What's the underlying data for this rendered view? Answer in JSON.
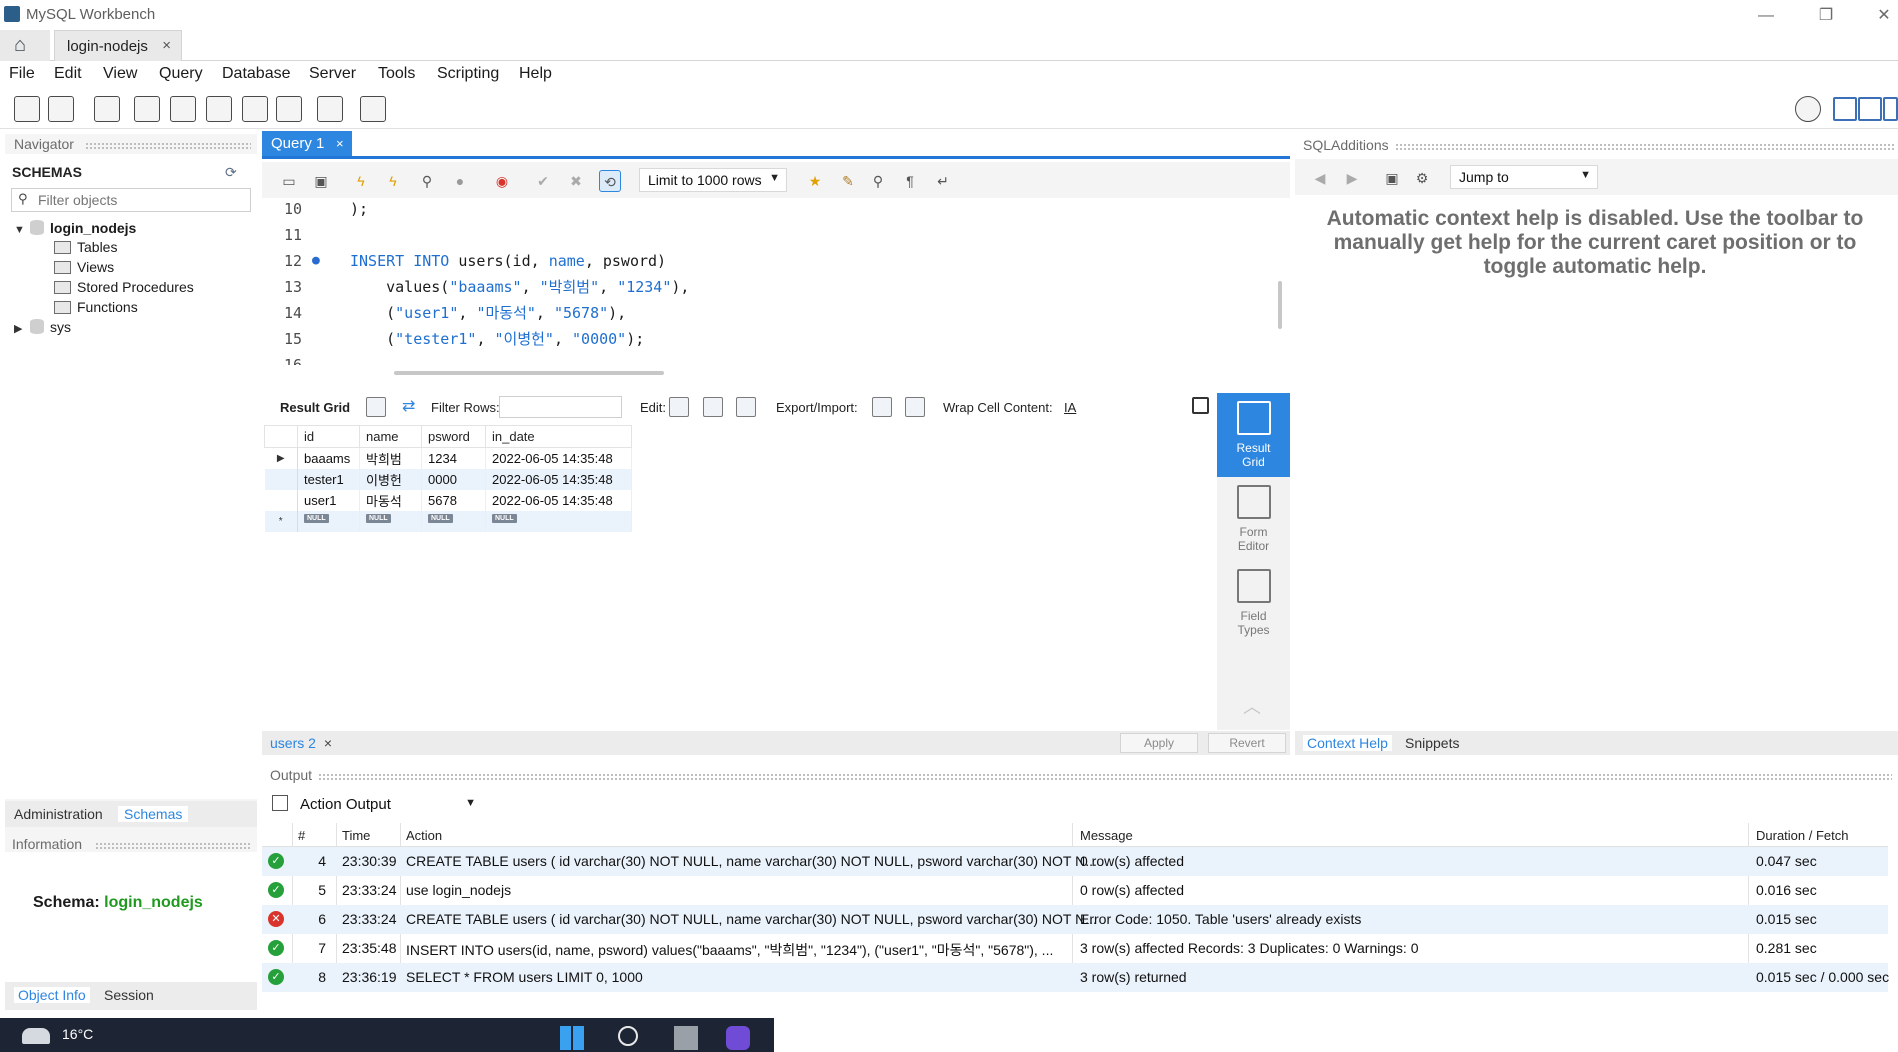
{
  "window": {
    "title": "MySQL Workbench",
    "min_glyph": "—",
    "max_glyph": "❐",
    "close_glyph": "✕"
  },
  "connection_tab": {
    "label": "login-nodejs",
    "close": "×"
  },
  "menu": [
    "File",
    "Edit",
    "View",
    "Query",
    "Database",
    "Server",
    "Tools",
    "Scripting",
    "Help"
  ],
  "navigator": {
    "caption": "Navigator",
    "schemas_title": "SCHEMAS",
    "filter_placeholder": "Filter objects",
    "tree": {
      "schema1": "login_nodejs",
      "children": [
        "Tables",
        "Views",
        "Stored Procedures",
        "Functions"
      ],
      "schema2": "sys"
    },
    "tabs": [
      "Administration",
      "Schemas"
    ],
    "info_caption": "Information",
    "schema_label": "Schema: ",
    "schema_value": "login_nodejs",
    "bottom_tabs": [
      "Object Info",
      "Session"
    ]
  },
  "query_tab": {
    "label": "Query 1",
    "close": "×"
  },
  "editor": {
    "limit": "Limit to 1000 rows",
    "lines": [
      {
        "n": "10",
        "parts": [
          {
            "t": ");",
            "c": ""
          }
        ]
      },
      {
        "n": "11",
        "parts": []
      },
      {
        "n": "12",
        "bullet": true,
        "parts": [
          {
            "t": "INSERT INTO",
            "c": "kw"
          },
          {
            "t": " users(id, ",
            "c": ""
          },
          {
            "t": "name",
            "c": "kw"
          },
          {
            "t": ", pswor​d)",
            "c": ""
          }
        ]
      },
      {
        "n": "13",
        "parts": [
          {
            "t": "    values(",
            "c": ""
          },
          {
            "t": "\"baaams\"",
            "c": "str"
          },
          {
            "t": ", ",
            "c": ""
          },
          {
            "t": "\"박희범\"",
            "c": "str"
          },
          {
            "t": ", ",
            "c": ""
          },
          {
            "t": "\"1234\"",
            "c": "str"
          },
          {
            "t": "),",
            "c": ""
          }
        ]
      },
      {
        "n": "14",
        "parts": [
          {
            "t": "    (",
            "c": ""
          },
          {
            "t": "\"user1\"",
            "c": "str"
          },
          {
            "t": ", ",
            "c": ""
          },
          {
            "t": "\"마동석\"",
            "c": "str"
          },
          {
            "t": ", ",
            "c": ""
          },
          {
            "t": "\"5678\"",
            "c": "str"
          },
          {
            "t": "),",
            "c": ""
          }
        ]
      },
      {
        "n": "15",
        "parts": [
          {
            "t": "    (",
            "c": ""
          },
          {
            "t": "\"tester1\"",
            "c": "str"
          },
          {
            "t": ", ",
            "c": ""
          },
          {
            "t": "\"이병헌\"",
            "c": "str"
          },
          {
            "t": ", ",
            "c": ""
          },
          {
            "t": "\"0000\"",
            "c": "str"
          },
          {
            "t": ");",
            "c": ""
          }
        ]
      },
      {
        "n": "16",
        "parts": []
      }
    ]
  },
  "result_toolbar": {
    "result_grid": "Result Grid",
    "filter_rows": "Filter Rows:",
    "edit": "Edit:",
    "export_import": "Export/Import:",
    "wrap": "Wrap Cell Content:"
  },
  "result": {
    "columns": [
      "id",
      "name",
      "psword",
      "in_date"
    ],
    "rows": [
      [
        "baaams",
        "박희범",
        "1234",
        "2022-06-05 14:35:48"
      ],
      [
        "tester1",
        "이병헌",
        "0000",
        "2022-06-05 14:35:48"
      ],
      [
        "user1",
        "마동석",
        "5678",
        "2022-06-05 14:35:48"
      ]
    ],
    "null_label": "NULL",
    "new_row_marker": "*",
    "current_row_marker": "▶"
  },
  "side_panel": [
    {
      "line1": "Result",
      "line2": "Grid"
    },
    {
      "line1": "Form",
      "line2": "Editor"
    },
    {
      "line1": "Field",
      "line2": "Types"
    }
  ],
  "result_tab": {
    "label": "users 2",
    "close": "×"
  },
  "apply_label": "Apply",
  "revert_label": "Revert",
  "sql_additions": {
    "caption": "SQLAdditions",
    "jump_to": "Jump to",
    "help": "Automatic context help is disabled. Use the toolbar to manually get help for the current caret position or to toggle automatic help.",
    "tabs": [
      "Context Help",
      "Snippets"
    ]
  },
  "output": {
    "caption": "Output",
    "selector": "Action Output",
    "headers": [
      "#",
      "Time",
      "Action",
      "Message",
      "Duration / Fetch"
    ],
    "rows": [
      {
        "status": "ok",
        "n": "4",
        "time": "23:30:39",
        "action": "CREATE TABLE users ( id varchar(30) NOT NULL, name varchar(30) NOT NULL, psword varchar(30) NOT N...",
        "message": "0 row(s) affected",
        "duration": "0.047 sec"
      },
      {
        "status": "ok",
        "n": "5",
        "time": "23:33:24",
        "action": "use login_nodejs",
        "message": "0 row(s) affected",
        "duration": "0.016 sec"
      },
      {
        "status": "err",
        "n": "6",
        "time": "23:33:24",
        "action": "CREATE TABLE users ( id varchar(30) NOT NULL, name varchar(30) NOT NULL, psword varchar(30) NOT N...",
        "message": "Error Code: 1050. Table 'users' already exists",
        "duration": "0.015 sec"
      },
      {
        "status": "ok",
        "n": "7",
        "time": "23:35:48",
        "action": "INSERT INTO users(id, name, psword) values(\"baaams\", \"박희범\", \"1234\"),    (\"user1\", \"마동석\", \"5678\"),   ...",
        "message": "3 row(s) affected Records: 3  Duplicates: 0  Warnings: 0",
        "duration": "0.281 sec"
      },
      {
        "status": "ok",
        "n": "8",
        "time": "23:36:19",
        "action": "SELECT * FROM users LIMIT 0, 1000",
        "message": "3 row(s) returned",
        "duration": "0.015 sec / 0.000 sec"
      }
    ]
  },
  "taskbar": {
    "weather": "16°C"
  },
  "colors": {
    "accent": "#2d86e0",
    "ok": "#26a03a",
    "error": "#d9342b",
    "keyword": "#1f6fd1",
    "schema_green": "#1f9a1f"
  }
}
